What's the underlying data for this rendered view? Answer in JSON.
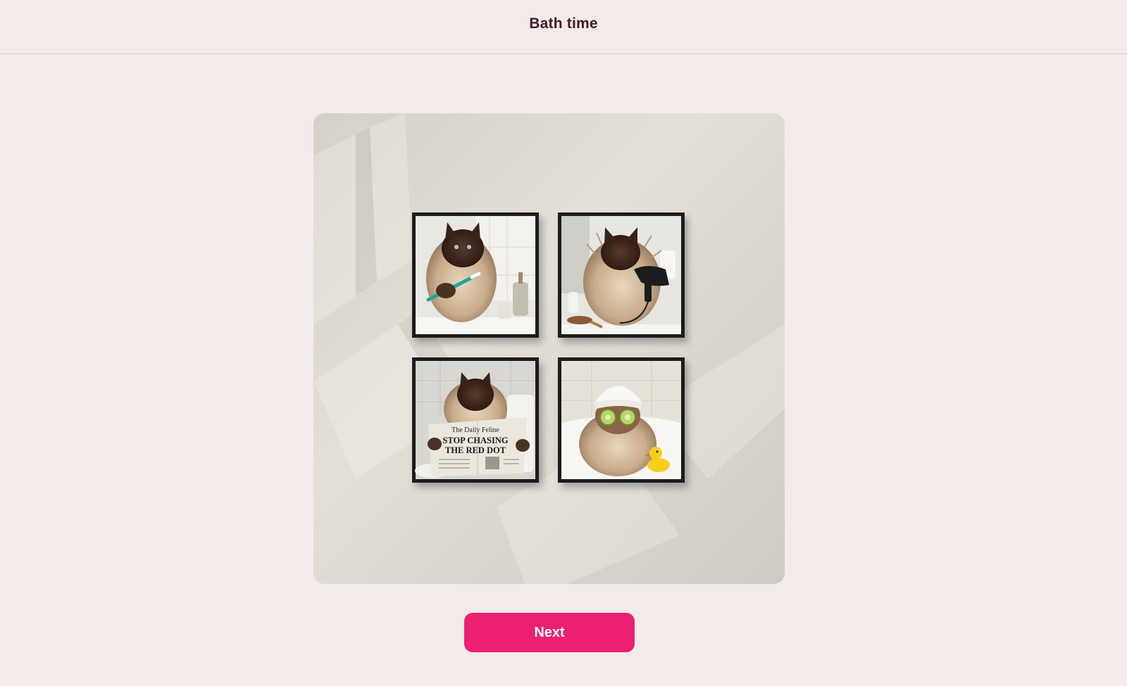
{
  "header": {
    "title": "Bath time"
  },
  "hero": {
    "frames": [
      {
        "caption": "",
        "scene": "cat-brushing-teeth"
      },
      {
        "caption": "",
        "scene": "cat-with-hair-dryer"
      },
      {
        "caption": "",
        "scene": "cat-reading-newspaper"
      },
      {
        "caption": "",
        "scene": "cat-spa-cucumbers"
      }
    ],
    "newspaper": {
      "masthead": "The Daily Feline",
      "headline_line1": "STOP CHASING",
      "headline_line2": "THE RED DOT"
    }
  },
  "actions": {
    "next_label": "Next"
  },
  "colors": {
    "accent": "#ec1f73",
    "background": "#f3ebe9",
    "title": "#3a1f2a"
  }
}
